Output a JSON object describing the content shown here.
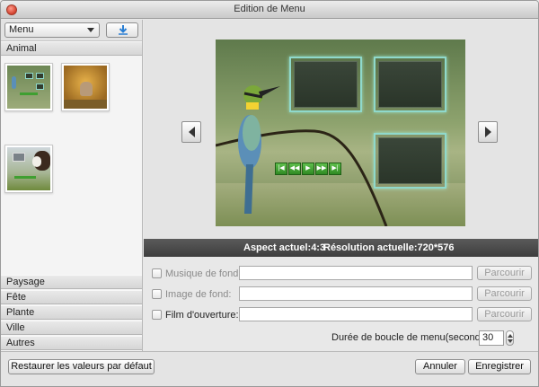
{
  "window": {
    "title": "Edition de Menu"
  },
  "sidebar": {
    "select_value": "Menu",
    "categories": {
      "animal": "Animal",
      "paysage": "Paysage",
      "fete": "Fête",
      "plante": "Plante",
      "ville": "Ville",
      "autres": "Autres"
    }
  },
  "info": {
    "aspect": "Aspect actuel:4:3",
    "resolution": "Résolution actuelle:720*576"
  },
  "settings": {
    "music_label": "Musique de fond:",
    "image_label": "Image de fond:",
    "film_label": "Film d'ouverture:",
    "browse_label": "Parcourir",
    "loop_label": "Durée de boucle de menu(secondes):",
    "loop_value": "30"
  },
  "buttons": {
    "restore": "Restaurer les valeurs par défaut",
    "cancel": "Annuler",
    "save": "Enregistrer"
  },
  "colors": {
    "frame_border": "#8fd9cc",
    "player_controls": "#3f9f31",
    "infobar": "#4a4a4a"
  },
  "icons": {
    "download": "download-icon",
    "prev": "chevron-left-icon",
    "next": "chevron-right-icon",
    "player_controls": [
      "skip-first-icon",
      "rewind-icon",
      "play-icon",
      "fast-forward-icon",
      "skip-last-icon"
    ]
  }
}
